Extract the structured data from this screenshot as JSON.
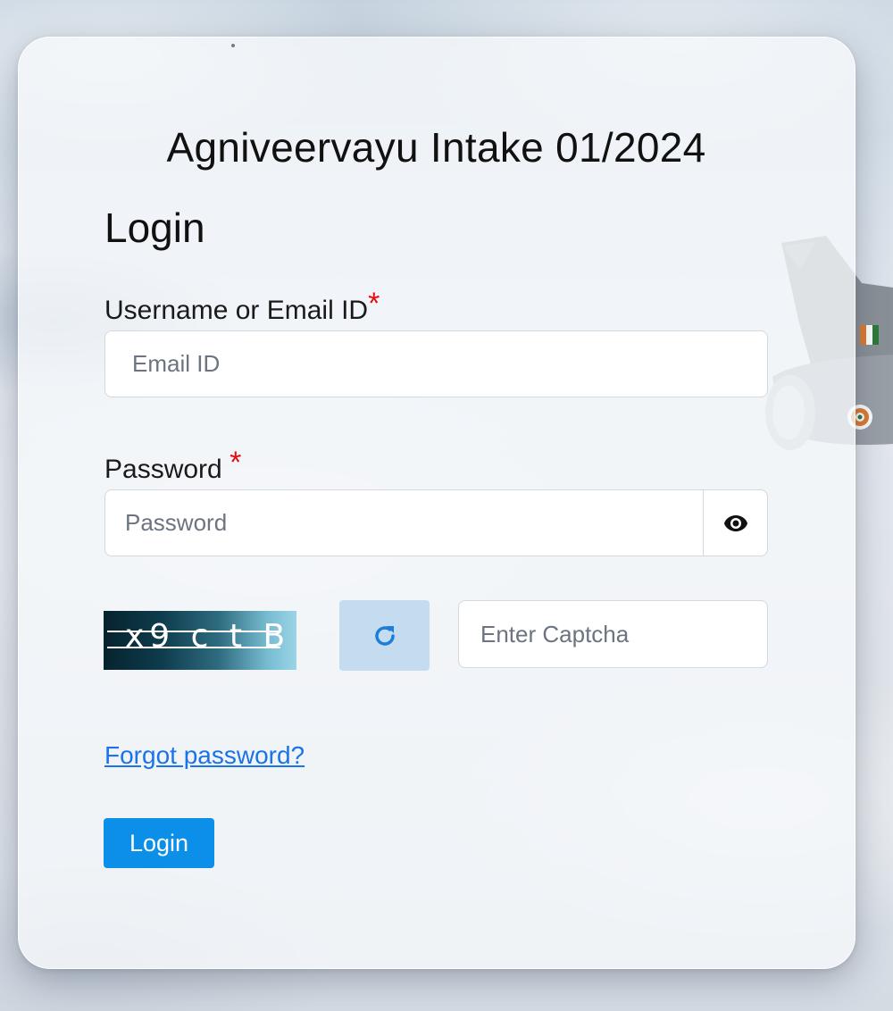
{
  "background": {
    "theme": "sky-with-jet"
  },
  "form": {
    "title": "Agniveervayu Intake 01/2024",
    "heading": "Login",
    "username": {
      "label": "Username or Email ID",
      "required_marker": "*",
      "placeholder": "Email ID",
      "value": ""
    },
    "password": {
      "label": "Password",
      "required_marker": "*",
      "placeholder": "Password",
      "value": "",
      "toggle_icon": "eye-icon"
    },
    "captcha": {
      "image_text": "x9 c t B",
      "refresh_icon": "refresh-icon",
      "placeholder": "Enter Captcha",
      "value": ""
    },
    "forgot_link": "Forgot password?",
    "submit_label": "Login"
  },
  "colors": {
    "accent": "#0b8fe8",
    "link": "#1a73e8",
    "required": "#e01010",
    "refresh_bg": "#c5dcf0"
  }
}
